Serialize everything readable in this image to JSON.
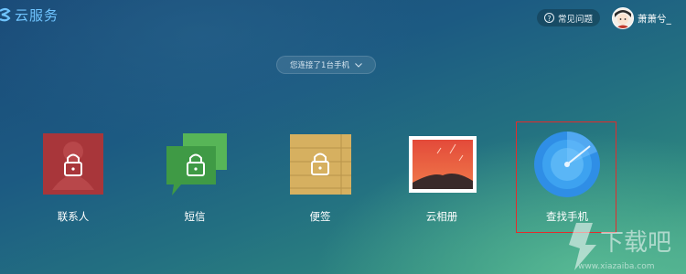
{
  "header": {
    "brand_name": "云服务",
    "faq_label": "常见问题",
    "username": "萧萧兮_"
  },
  "device_selector": {
    "label": "您连接了1台手机"
  },
  "apps": [
    {
      "label": "联系人",
      "icon": "contacts-lock-icon",
      "color": "#a8363a"
    },
    {
      "label": "短信",
      "icon": "messages-lock-icon",
      "color": "#43a047"
    },
    {
      "label": "便签",
      "icon": "notes-lock-icon",
      "color": "#d6b060"
    },
    {
      "label": "云相册",
      "icon": "cloud-album-icon",
      "color": "#e35a3d"
    },
    {
      "label": "查找手机",
      "icon": "find-phone-radar-icon",
      "color": "#2f8ee6"
    }
  ],
  "watermark": {
    "name": "下载吧",
    "url": "www.xiazaiba.com"
  },
  "colors": {
    "brand_blue": "#6fc4ff",
    "highlight_red": "#e22c2c"
  }
}
